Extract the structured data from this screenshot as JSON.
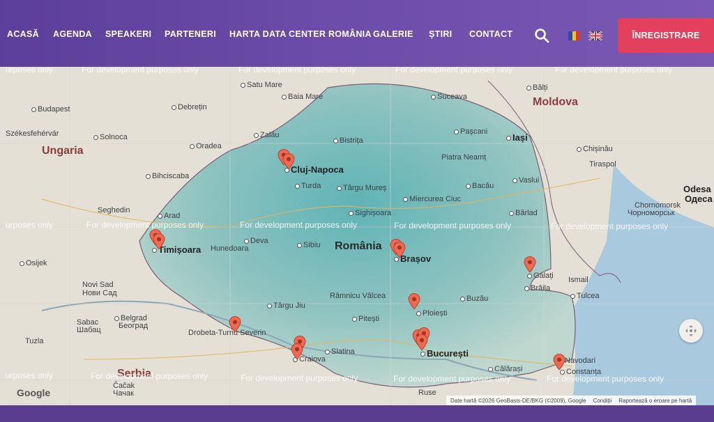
{
  "nav": {
    "items": [
      "ACASĂ",
      "AGENDA",
      "SPEAKERI",
      "PARTENERI",
      "HARTA DATA CENTER ROMÂNIA",
      "GALERIE",
      "ȘTIRI",
      "CONTACT"
    ],
    "register_label": "ÎNREGISTRARE"
  },
  "map": {
    "watermark_text": "For development purposes only",
    "watermark_partial": "urposes only",
    "countries": [
      "Ungaria",
      "Moldova",
      "România",
      "Serbia"
    ],
    "cities": [
      "Budapest",
      "Székesfehérvár",
      "Solnoca",
      "Debrețin",
      "Satu Mare",
      "Baia Mare",
      "Suceava",
      "Bălți",
      "Zalău",
      "Bistrița",
      "Pașcani",
      "Iași",
      "Chișinău",
      "Tiraspol",
      "Oradea",
      "Cluj-Napoca",
      "Piatra Neamț",
      "Bihciscaba",
      "Turda",
      "Târgu Mureș",
      "Bacău",
      "Vaslui",
      "Miercurea Ciuc",
      "Seghedin",
      "Arad",
      "Sighișoara",
      "Bârlad",
      "Timișoara",
      "Deva",
      "Sibiu",
      "Brașov",
      "Hunedoara",
      "Galați",
      "Brăila",
      "Novi Sad",
      "Нови Сад",
      "Osijek",
      "Râmnicu Vâlcea",
      "Buzău",
      "Târgu Jiu",
      "Ploiești",
      "Tulcea",
      "Ismail",
      "Belgrad",
      "Београд",
      "Sabac",
      "Шабац",
      "Drobeta-Turnu Severin",
      "Pitești",
      "Craiova",
      "Slatina",
      "București",
      "Constanța",
      "Navodari",
      "Odesa",
      "Одеса",
      "Chornomorsk",
      "Чорноморськ",
      "Tuzla",
      "Čačak",
      "Чачак",
      "Ruse",
      "Călărași"
    ],
    "attribution": [
      "Date hartă ©2026 GeoBasis-DE/BKG (©2009), Google",
      "Condiții",
      "Raportează o eroare pe hartă"
    ],
    "logo": "Google"
  },
  "colors": {
    "nav": "#6b4ca8",
    "register": "#e2405d",
    "pin": "#ee6a52"
  }
}
